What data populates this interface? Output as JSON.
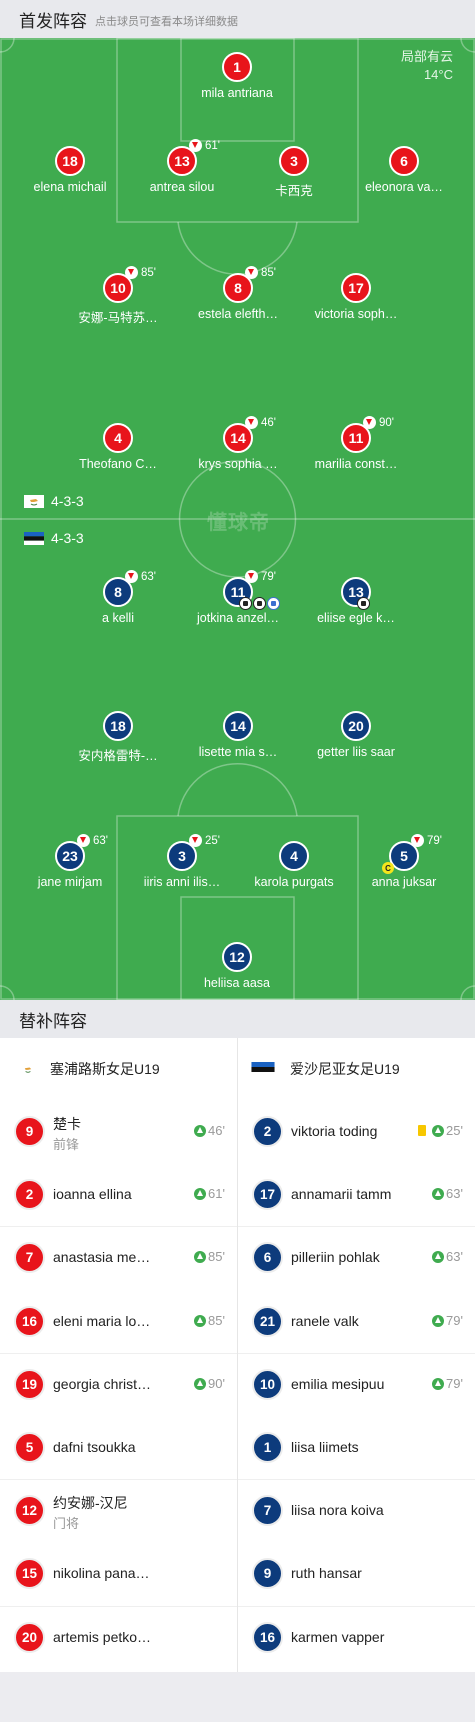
{
  "lineup_header": {
    "title": "首发阵容",
    "subtitle": "点击球员可查看本场详细数据"
  },
  "weather": {
    "condition": "局部有云",
    "temperature": "14°C"
  },
  "watermark": "懂球帝",
  "home": {
    "formation": "4-3-3",
    "flag_colors": [
      "#ffffff",
      "#e2a03a",
      "#3c7a3a"
    ],
    "players": [
      {
        "num": "1",
        "name": "mila antriana"
      },
      {
        "num": "18",
        "name": "elena michail"
      },
      {
        "num": "13",
        "name": "antrea silou",
        "sub": "61'"
      },
      {
        "num": "3",
        "name": "卡西克"
      },
      {
        "num": "6",
        "name": "eleonora va…"
      },
      {
        "num": "10",
        "name": "安娜-马特苏…",
        "sub": "85'"
      },
      {
        "num": "8",
        "name": "estela elefth…",
        "sub": "85'"
      },
      {
        "num": "17",
        "name": "victoria soph…"
      },
      {
        "num": "4",
        "name": "Theofano C…"
      },
      {
        "num": "14",
        "name": "krys sophia …",
        "sub": "46'"
      },
      {
        "num": "11",
        "name": "marilia const…",
        "sub": "90'"
      }
    ]
  },
  "away": {
    "formation": "4-3-3",
    "flag_colors": [
      "#1a62c2",
      "#111111",
      "#ffffff"
    ],
    "players": [
      {
        "num": "8",
        "name": "a kelli",
        "sub": "63'"
      },
      {
        "num": "11",
        "name": "jotkina anzel…",
        "sub": "79'",
        "events": [
          "goal",
          "goal",
          "own-goal"
        ]
      },
      {
        "num": "13",
        "name": "eliise egle k…",
        "events": [
          "goal"
        ]
      },
      {
        "num": "18",
        "name": "安内格雷特-…"
      },
      {
        "num": "14",
        "name": "lisette mia s…"
      },
      {
        "num": "20",
        "name": "getter liis saar"
      },
      {
        "num": "23",
        "name": "jane mirjam",
        "sub": "63'"
      },
      {
        "num": "3",
        "name": "iiris anni ilis…",
        "sub": "25'"
      },
      {
        "num": "4",
        "name": "karola purgats"
      },
      {
        "num": "5",
        "name": "anna juksar",
        "sub": "79'",
        "captain": "C"
      },
      {
        "num": "12",
        "name": "heliisa aasa"
      }
    ]
  },
  "bench_header": {
    "title": "替补阵容"
  },
  "bench": {
    "home_team": "塞浦路斯女足U19",
    "away_team": "爱沙尼亚女足U19",
    "home": [
      {
        "num": "9",
        "name": "楚卡",
        "pos": "前锋",
        "in": "46'"
      },
      {
        "num": "2",
        "name": "ioanna ellina",
        "in": "61'"
      },
      {
        "num": "7",
        "name": "anastasia me…",
        "in": "85'"
      },
      {
        "num": "16",
        "name": "eleni maria lo…",
        "in": "85'"
      },
      {
        "num": "19",
        "name": "georgia christ…",
        "in": "90'"
      },
      {
        "num": "5",
        "name": "dafni tsoukka"
      },
      {
        "num": "12",
        "name": "约安娜-汉尼",
        "pos": "门将"
      },
      {
        "num": "15",
        "name": "nikolina pana…"
      },
      {
        "num": "20",
        "name": "artemis petko…"
      }
    ],
    "away": [
      {
        "num": "2",
        "name": "viktoria toding",
        "in": "25'",
        "card": "yellow"
      },
      {
        "num": "17",
        "name": "annamarii tamm",
        "in": "63'"
      },
      {
        "num": "6",
        "name": "pilleriin pohlak",
        "in": "63'"
      },
      {
        "num": "21",
        "name": "ranele valk",
        "in": "79'"
      },
      {
        "num": "10",
        "name": "emilia mesipuu",
        "in": "79'"
      },
      {
        "num": "1",
        "name": "liisa liimets"
      },
      {
        "num": "7",
        "name": "liisa nora koiva"
      },
      {
        "num": "9",
        "name": "ruth hansar"
      },
      {
        "num": "16",
        "name": "karmen vapper"
      }
    ]
  }
}
